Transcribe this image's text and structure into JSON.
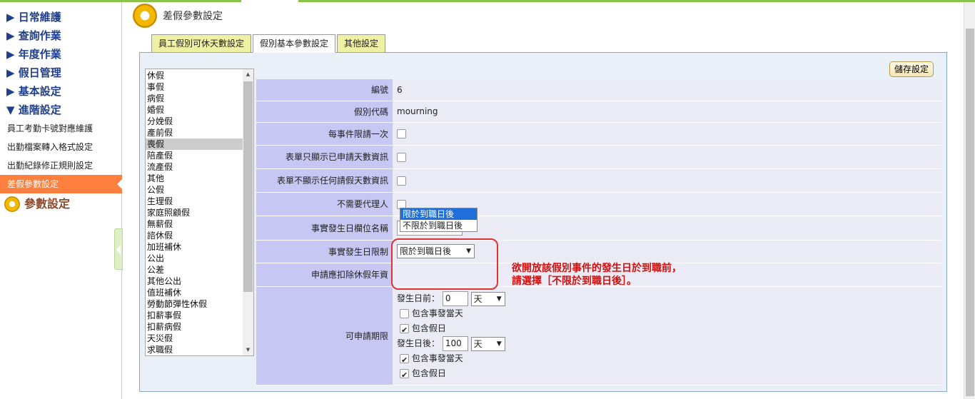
{
  "sidebar": {
    "main_items": [
      {
        "label": "▶ 日常維護"
      },
      {
        "label": "▶ 查詢作業"
      },
      {
        "label": "▶ 年度作業"
      },
      {
        "label": "▶ 假日管理"
      },
      {
        "label": "▶ 基本設定"
      },
      {
        "label": "▼ 進階設定"
      }
    ],
    "sub_items": [
      {
        "label": "員工考勤卡號對應維護"
      },
      {
        "label": "出勤檔案轉入格式設定"
      },
      {
        "label": "出勤紀錄修正規則設定"
      },
      {
        "label": "差假參數設定",
        "active": true
      }
    ],
    "group_title": "參數設定"
  },
  "header": {
    "title": "差假參數設定"
  },
  "tabs": [
    {
      "label": "員工假別可休天數設定"
    },
    {
      "label": "假別基本參數設定",
      "active": true
    },
    {
      "label": "其他設定"
    }
  ],
  "leave_types": [
    "休假",
    "事假",
    "病假",
    "婚假",
    "分娩假",
    "產前假",
    "喪假",
    "陪產假",
    "流產假",
    "其他",
    "公假",
    "生理假",
    "家庭照顧假",
    "無薪假",
    "諮休假",
    "加班補休",
    "公出",
    "公差",
    "其他公出",
    "值班補休",
    "勞動節彈性休假",
    "扣薪事假",
    "扣薪病假",
    "天災假",
    "求職假"
  ],
  "selected_leave": "喪假",
  "save_button": "儲存設定",
  "form": {
    "id": {
      "label": "編號",
      "value": "6"
    },
    "code": {
      "label": "假別代碼",
      "value": "mourning"
    },
    "once_per_event": {
      "label": "每事件限請一次",
      "checked": false
    },
    "show_applied_only": {
      "label": "表單只顯示已申請天數資訊",
      "checked": false
    },
    "hide_all_days": {
      "label": "表單不顯示任何請假天數資訊",
      "checked": false
    },
    "no_agent": {
      "label": "不需要代理人",
      "checked": false
    },
    "event_field": {
      "label": "事實發生日欄位名稱",
      "value": ""
    },
    "event_limit": {
      "label": "事實發生日限制",
      "value": "限於到職日後",
      "options": [
        "限於到職日後",
        "不限於到職日後"
      ]
    },
    "deduct_annual": {
      "label": "申請應扣除休假年資"
    },
    "period": {
      "label": "可申請期限",
      "before_label": "發生日前：",
      "before_value": "0",
      "before_unit": "天",
      "before_incl_day": {
        "label": "包含事發當天",
        "checked": false
      },
      "before_incl_holiday": {
        "label": "包含假日",
        "checked": true
      },
      "after_label": "發生日後：",
      "after_value": "100",
      "after_unit": "天",
      "after_incl_day": {
        "label": "包含事發當天",
        "checked": true
      },
      "after_incl_holiday": {
        "label": "包含假日",
        "checked": true
      }
    }
  },
  "annotation": {
    "line1": "欲開放該假別事件的發生日於到職前，",
    "line2": "請選擇［不限於到職日後］。",
    "color": "#d01010"
  },
  "colors": {
    "accent": "#8bc34a",
    "active_nav": "#ff7f3f",
    "nav_text": "#1f3e8c",
    "label_bg": "#c7c7f3"
  }
}
